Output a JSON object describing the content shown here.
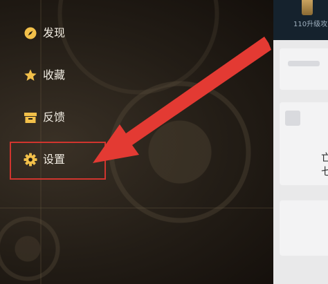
{
  "menu": {
    "items": [
      {
        "label": "发现",
        "icon": "compass-icon"
      },
      {
        "label": "收藏",
        "icon": "star-icon"
      },
      {
        "label": "反馈",
        "icon": "box-icon"
      },
      {
        "label": "设置",
        "icon": "gear-icon"
      }
    ]
  },
  "right_panel": {
    "level_text": "110升级攻",
    "partial_text_1": "亡",
    "partial_text_2": "七"
  },
  "annotation": {
    "color": "#d1352e",
    "highlighted_item": "设置"
  },
  "colors": {
    "icon_accent": "#f2c04a",
    "menu_text": "#f1ece2",
    "background": "#1a1510"
  }
}
